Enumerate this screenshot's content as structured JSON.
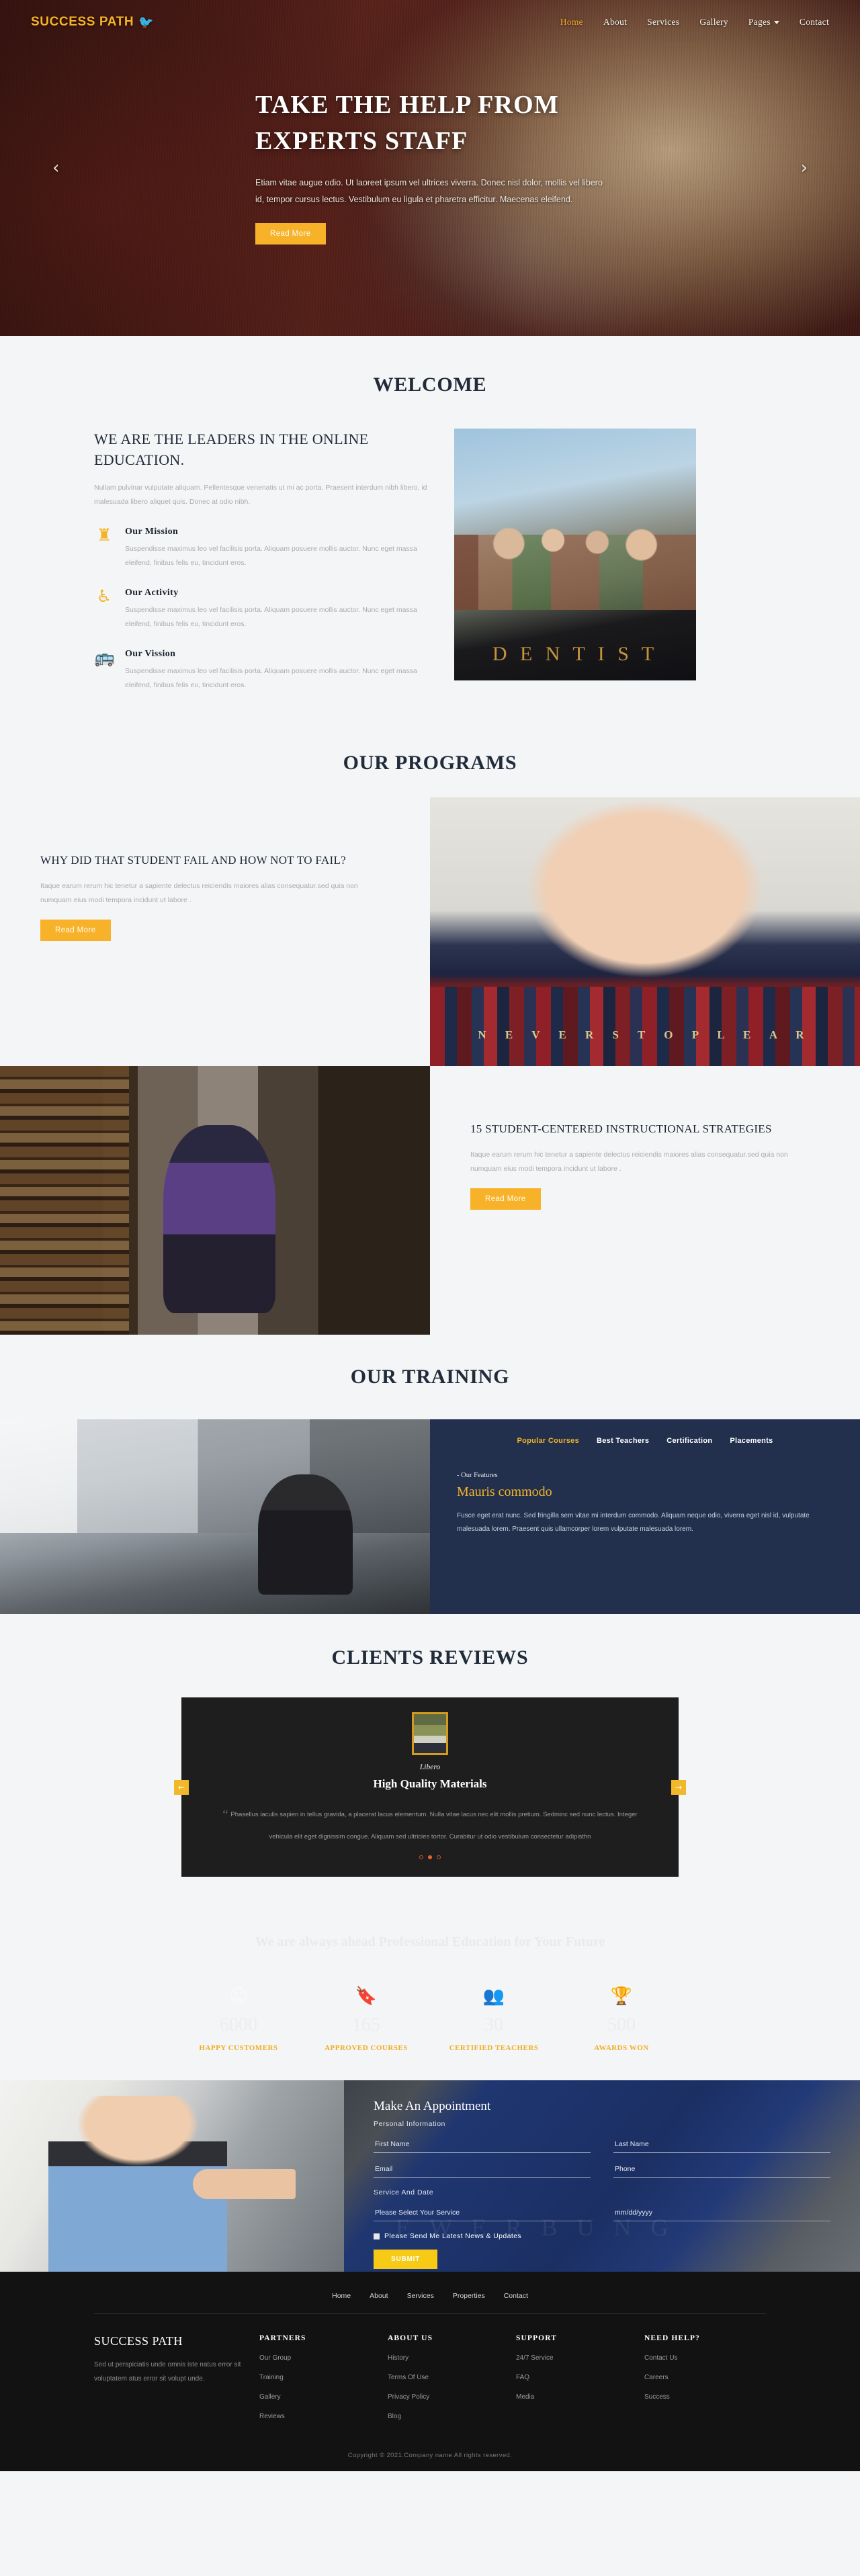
{
  "header": {
    "logo_text": "SUCCESS PATH",
    "logo_icon": "bird-icon",
    "nav": [
      {
        "label": "Home",
        "active": true
      },
      {
        "label": "About",
        "active": false
      },
      {
        "label": "Services",
        "active": false
      },
      {
        "label": "Gallery",
        "active": false
      },
      {
        "label": "Pages",
        "active": false,
        "has_dropdown": true
      },
      {
        "label": "Contact",
        "active": false
      }
    ]
  },
  "hero": {
    "title_line1": "TAKE THE HELP FROM",
    "title_line2": "EXPERTS STAFF",
    "paragraph": "Etiam vitae augue odio. Ut laoreet ipsum vel ultrices viverra. Donec nisl dolor, mollis vel libero id, tempor cursus lectus. Vestibulum eu ligula et pharetra efficitur. Maecenas eleifend.",
    "button": "Read More",
    "prev_arrow": "‹",
    "next_arrow": "›"
  },
  "welcome": {
    "section_title": "WELCOME",
    "heading": "WE ARE THE LEADERS IN THE ONLINE EDUCATION.",
    "paragraph": "Nullam pulvinar vulputate aliquam. Pellentesque venenatis ut mi ac porta. Praesent interdum nibh libero, id malesuada libero aliquet quis. Donec at odio nibh.",
    "features": [
      {
        "icon": "tower-icon",
        "glyph": "♜",
        "title": "Our Mission",
        "text": "Suspendisse maximus leo vel facilisis porta. Aliquam posuere mollis auctor. Nunc eget massa eleifend, finibus felis eu, tincidunt eros."
      },
      {
        "icon": "accessibility-icon",
        "glyph": "♿",
        "title": "Our Activity",
        "text": "Suspendisse maximus leo vel facilisis porta. Aliquam posuere mollis auctor. Nunc eget massa eleifend, finibus felis eu, tincidunt eros."
      },
      {
        "icon": "bus-icon",
        "glyph": "ὨC",
        "title": "Our Vission",
        "text": "Suspendisse maximus leo vel facilisis porta. Aliquam posuere mollis auctor. Nunc eget massa eleifend, finibus felis eu, tincidunt eros."
      }
    ],
    "image_caption": "D   E   N   T   I   S   T"
  },
  "programs": {
    "section_title": "OUR PROGRAMS",
    "items": [
      {
        "title": "WHY DID THAT STUDENT FAIL AND HOW NOT TO FAIL?",
        "text": "Itaque earum rerum hic tenetur a sapiente delectus reiciendis maiores alias consequatur.sed quia non numquam eius modi tempora incidunt ut labore .",
        "button": "Read More",
        "image_text": "N E V E R   S T O P   L E A R"
      },
      {
        "title": "15 STUDENT-CENTERED INSTRUCTIONAL STRATEGIES",
        "text": "Itaque earum rerum hic tenetur a sapiente delectus reiciendis maiores alias consequatur.sed quia non numquam eius modi tempora incidunt ut labore .",
        "button": "Read More"
      }
    ]
  },
  "training": {
    "section_title": "OUR TRAINING",
    "tabs": [
      {
        "label": "Popular Courses",
        "active": true
      },
      {
        "label": "Best Teachers",
        "active": false
      },
      {
        "label": "Certification",
        "active": false
      },
      {
        "label": "Placements",
        "active": false
      }
    ],
    "kicker": "- Our Features",
    "title": "Mauris commodo",
    "text": "Fusce eget erat nunc. Sed fringilla sem vitae mi interdum commodo. Aliquam neque odio, viverra eget nisl id, vulputate malesuada lorem. Praesent quis ullamcorper lorem vulputate malesuada lorem."
  },
  "reviews": {
    "section_title": "CLIENTS REVIEWS",
    "name": "Libero",
    "title": "High Quality Materials",
    "quote_glyph": "“",
    "text": "Phasellus iaculis sapien in tellus gravida, a placerat lacus elementum. Nulla vitae lacus nec elit mollis pretium. Sedminc sed nunc lectus. Integer vehicula elit eget dignissim congue. Aliquam sed ultricies tortor. Curabitur ut odio vestibulum consectetur adipisthn",
    "prev_arrow": "←",
    "next_arrow": "→",
    "dot_count": 3,
    "active_dot": 2
  },
  "counters": {
    "heading": "We are always ahead Professional Education for Your Future",
    "items": [
      {
        "icon": "smiley-icon",
        "glyph": "☺",
        "value": "6000",
        "label": "HAPPY CUSTOMERS"
      },
      {
        "icon": "bookmark-icon",
        "glyph": "ὑ6",
        "value": "165",
        "label": "APPROVED COURSES"
      },
      {
        "icon": "people-icon",
        "glyph": "὆5",
        "value": "30",
        "label": "CERTIFIED TEACHERS"
      },
      {
        "icon": "trophy-icon",
        "glyph": "Ἴ6",
        "value": "500",
        "label": "AWARDS WON"
      }
    ]
  },
  "appointment": {
    "title": "Make An Appointment",
    "personal_label": "Personal Information",
    "first_name_placeholder": "First Name",
    "last_name_placeholder": "Last Name",
    "email_placeholder": "Email",
    "phone_placeholder": "Phone",
    "service_label": "Service And Date",
    "service_placeholder": "Please Select Your Service",
    "date_placeholder": "mm/dd/yyyy",
    "checkbox_label": "Please Send Me Latest News & Updates",
    "submit_label": "SUBMIT"
  },
  "footer": {
    "nav": [
      "Home",
      "About",
      "Services",
      "Properties",
      "Contact"
    ],
    "brand": "SUCCESS PATH",
    "brand_text": "Sed ut perspiciatis unde omnis iste natus error sit voluptatem atus error sit volupt unde.",
    "columns": [
      {
        "heading": "PARTNERS",
        "links": [
          "Our Group",
          "Training",
          "Gallery",
          "Reviews"
        ]
      },
      {
        "heading": "ABOUT US",
        "links": [
          "History",
          "Terms Of Use",
          "Privacy Policy",
          "Blog"
        ]
      },
      {
        "heading": "SUPPORT",
        "links": [
          "24/7 Service",
          "FAQ",
          "Media"
        ]
      },
      {
        "heading": "NEED HELP?",
        "links": [
          "Contact Us",
          "Careers",
          "Success"
        ]
      }
    ],
    "copyright": "Copyright © 2021.Company name All rights reserved."
  },
  "colors": {
    "accent_yellow": "#f5b324",
    "dark_navy": "#23304d",
    "hero_maroon": "#5c211a",
    "footer_black": "#121212"
  }
}
